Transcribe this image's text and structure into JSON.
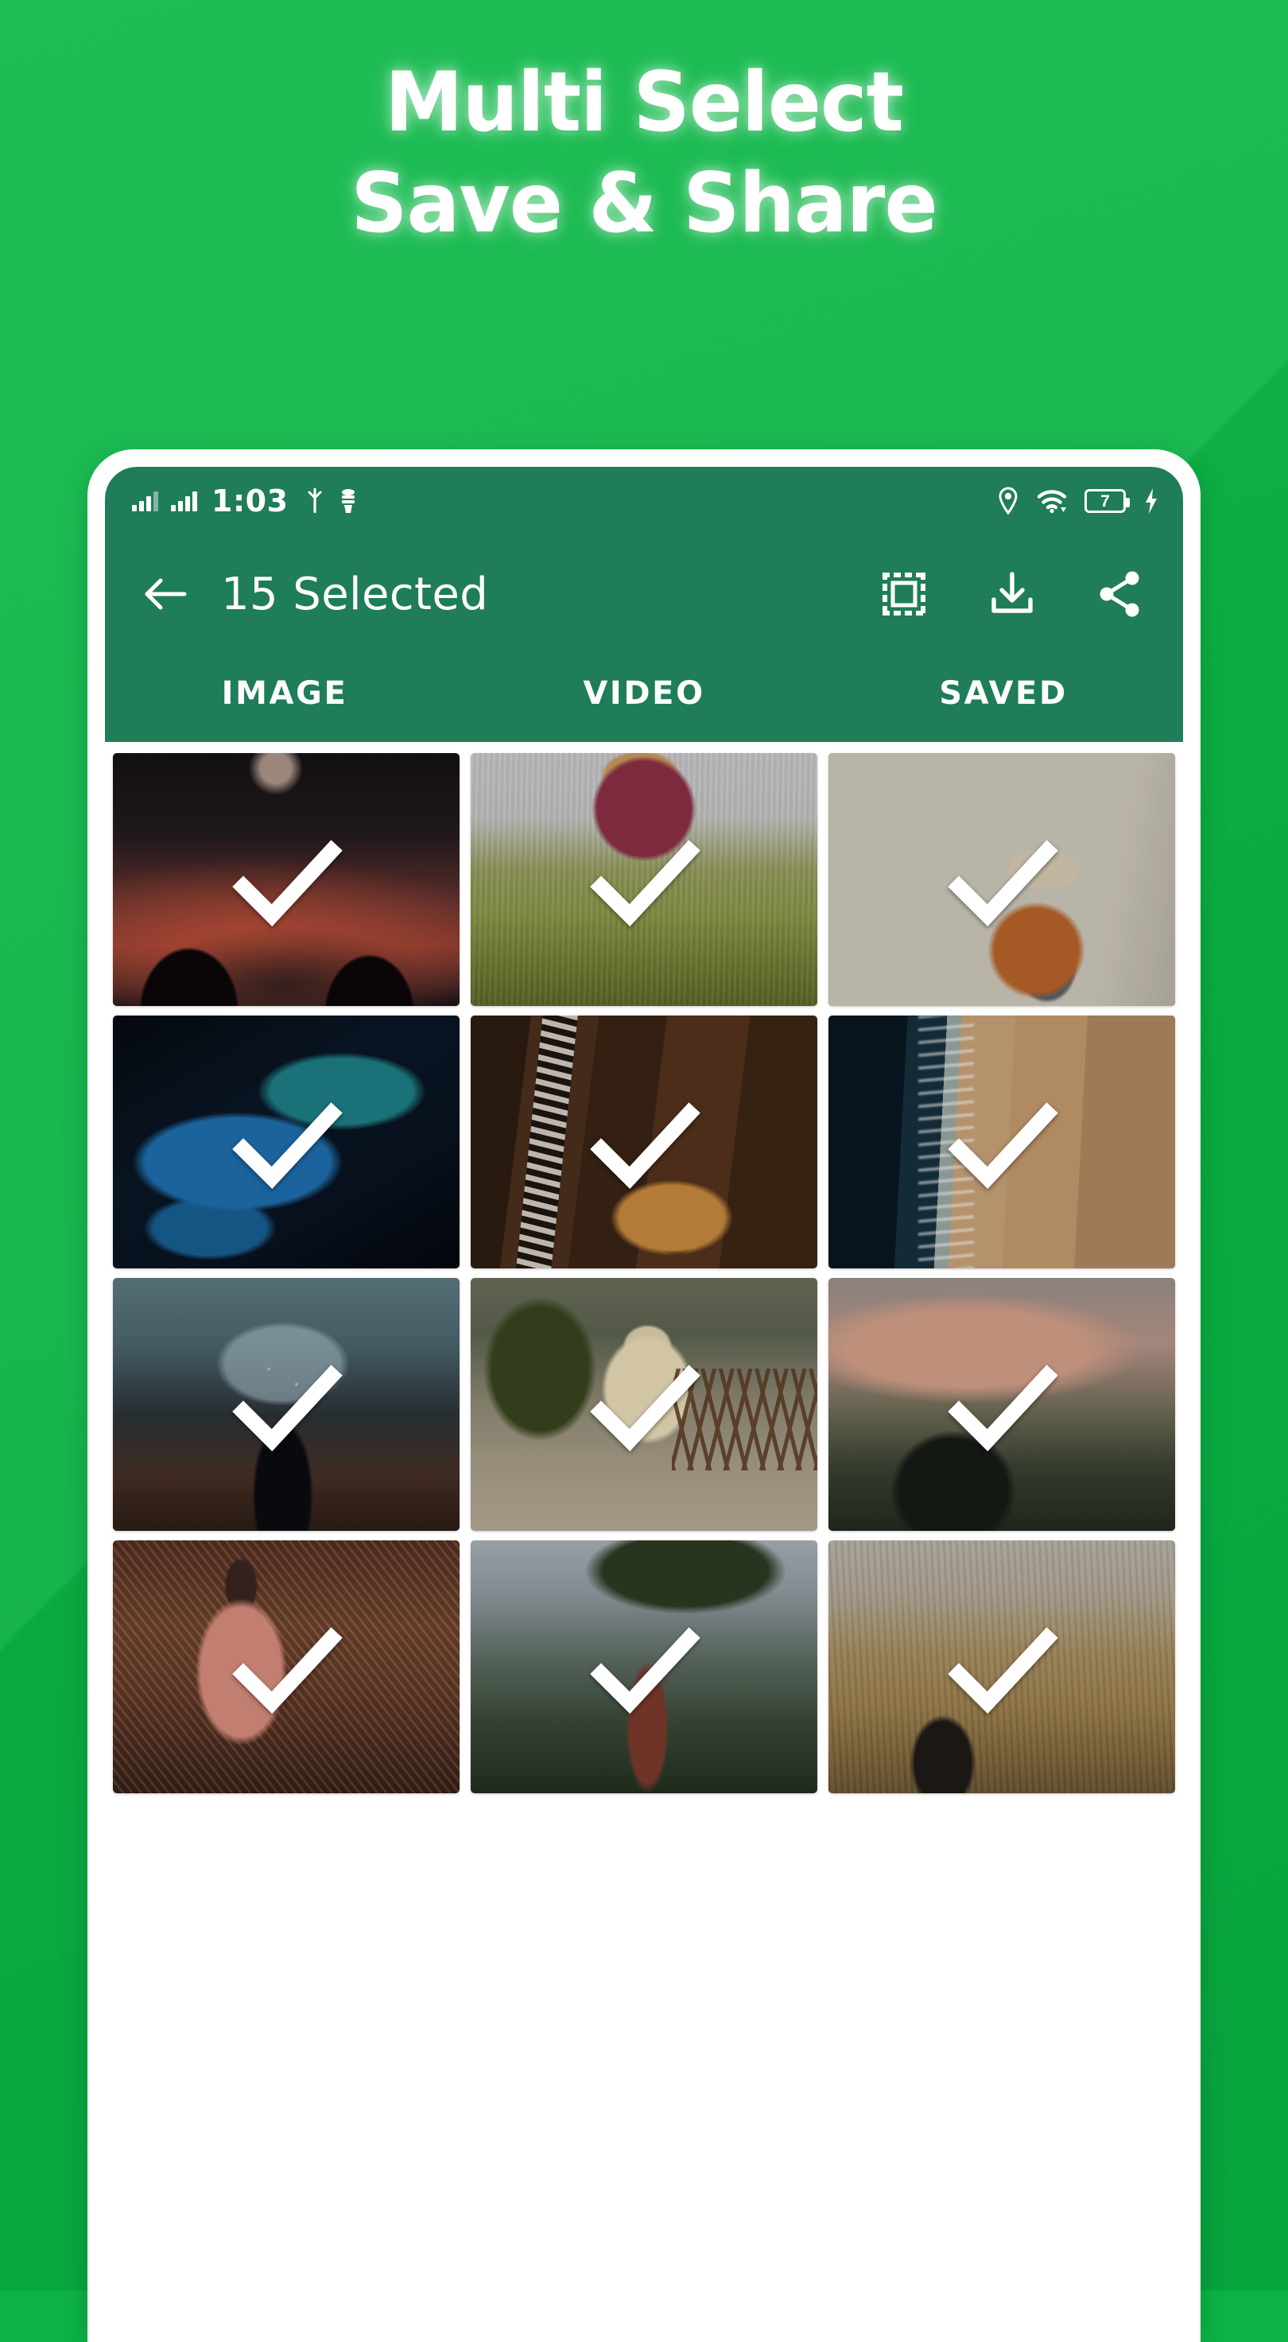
{
  "promo": {
    "headline_line1": "Multi Select",
    "headline_line2": "Save & Share",
    "background_color": "#0cb246",
    "text_color": "#ffffff"
  },
  "phone": {
    "frame_color": "#ffffff",
    "accent_color": "#1f7d58"
  },
  "status_bar": {
    "time": "1:03",
    "battery_level": "7",
    "icons_left": [
      "signal-icon",
      "signal-icon",
      "usb-icon",
      "sdcard-icon"
    ],
    "icons_right": [
      "location-pin-icon",
      "wifi-icon",
      "battery-icon",
      "charging-bolt-icon"
    ]
  },
  "app_bar": {
    "back_label": "back-arrow",
    "title": "15 Selected",
    "actions": [
      {
        "name": "select-all-button",
        "icon": "select-all-icon"
      },
      {
        "name": "download-button",
        "icon": "download-icon"
      },
      {
        "name": "share-button",
        "icon": "share-icon"
      }
    ]
  },
  "tabs": {
    "items": [
      {
        "label": "IMAGE",
        "active": true
      },
      {
        "label": "VIDEO",
        "active": false
      },
      {
        "label": "SAVED",
        "active": false
      }
    ],
    "active_index": 0
  },
  "grid": {
    "selected_count": 15,
    "columns": 3,
    "check_icon": "checkmark-icon",
    "items": [
      {
        "id": 1,
        "description": "Couple silhouette at sunset",
        "selected": true,
        "style": "ph-sunset-couple"
      },
      {
        "id": 2,
        "description": "Woman in red dress in tall grass field",
        "selected": true,
        "style": "ph-field-girl"
      },
      {
        "id": 3,
        "description": "Hiker with backpack on forest trail",
        "selected": true,
        "style": "ph-forest-hiker"
      },
      {
        "id": 4,
        "description": "Blue leaves with water droplets at night",
        "selected": true,
        "style": "ph-blue-leaves"
      },
      {
        "id": 5,
        "description": "Acoustic guitar on wooden floor",
        "selected": true,
        "style": "ph-guitar"
      },
      {
        "id": 6,
        "description": "Aerial view of ocean waves and sandy beach",
        "selected": true,
        "style": "ph-beach"
      },
      {
        "id": 7,
        "description": "Person with lit umbrella on bridge at dusk",
        "selected": true,
        "style": "ph-umbrella"
      },
      {
        "id": 8,
        "description": "Golden retriever holding a flower",
        "selected": true,
        "style": "ph-dog"
      },
      {
        "id": 9,
        "description": "Person on hillside at dusk",
        "selected": true,
        "style": "ph-hill-dusk"
      },
      {
        "id": 10,
        "description": "Person in pink jacket by chain-link fence",
        "selected": true,
        "style": "ph-pink-jacket"
      },
      {
        "id": 11,
        "description": "Tree overlooking misty valley",
        "selected": true,
        "style": "ph-tree-valley"
      },
      {
        "id": 12,
        "description": "Person in golden wheat field",
        "selected": true,
        "style": "ph-wheat-field"
      }
    ]
  }
}
